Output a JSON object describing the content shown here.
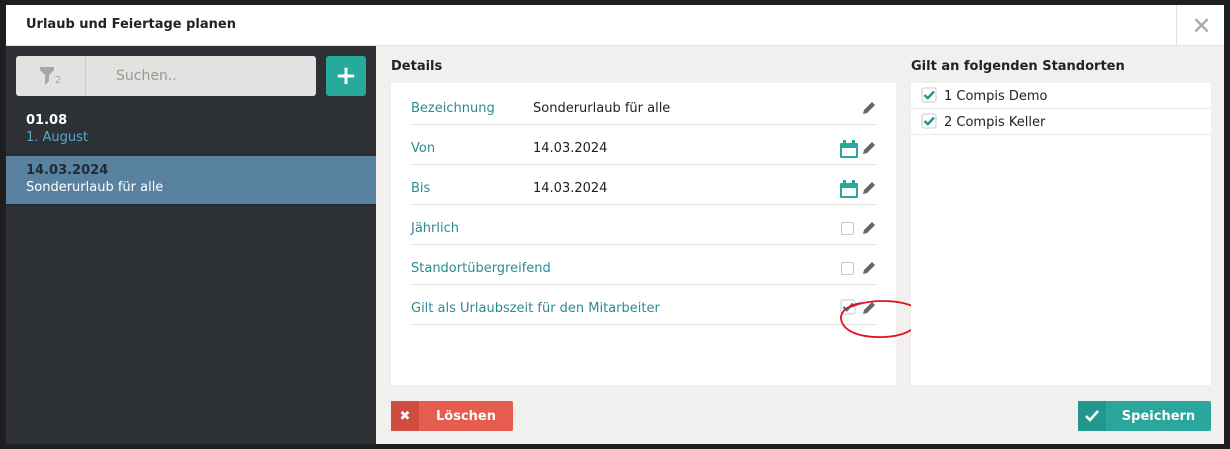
{
  "dialog": {
    "title": "Urlaub und Feiertage planen",
    "close_glyph": "✕"
  },
  "sidebar": {
    "filter_count": "2",
    "search_placeholder": "Suchen..",
    "add_glyph": "+",
    "items": [
      {
        "date": "01.08",
        "name": "1. August",
        "selected": false
      },
      {
        "date": "14.03.2024",
        "name": "Sonderurlaub für alle",
        "selected": true
      }
    ]
  },
  "details": {
    "title": "Details",
    "fields": [
      {
        "label": "Bezeichnung",
        "value": "Sonderurlaub für alle",
        "kind": "text"
      },
      {
        "label": "Von",
        "value": "14.03.2024",
        "kind": "date"
      },
      {
        "label": "Bis",
        "value": "14.03.2024",
        "kind": "date"
      },
      {
        "label": "Jährlich",
        "checked": false,
        "kind": "checkbox"
      },
      {
        "label": "Standortübergreifend",
        "checked": false,
        "kind": "checkbox"
      },
      {
        "label": "Gilt als Urlaubszeit für den Mitarbeiter",
        "checked": true,
        "kind": "checkbox",
        "highlighted": true
      }
    ]
  },
  "locations": {
    "title": "Gilt an folgenden Standorten",
    "items": [
      {
        "label": "1 Compis Demo",
        "checked": true
      },
      {
        "label": "2 Compis Keller",
        "checked": true
      }
    ]
  },
  "buttons": {
    "delete": {
      "label": "Löschen",
      "icon": "✖"
    },
    "save": {
      "label": "Speichern"
    }
  },
  "colors": {
    "accent": "#27a99c",
    "danger": "#e65c4f",
    "selected_item": "#5882a0",
    "sidebar": "#2d3136",
    "annotation": "#e0141e"
  }
}
